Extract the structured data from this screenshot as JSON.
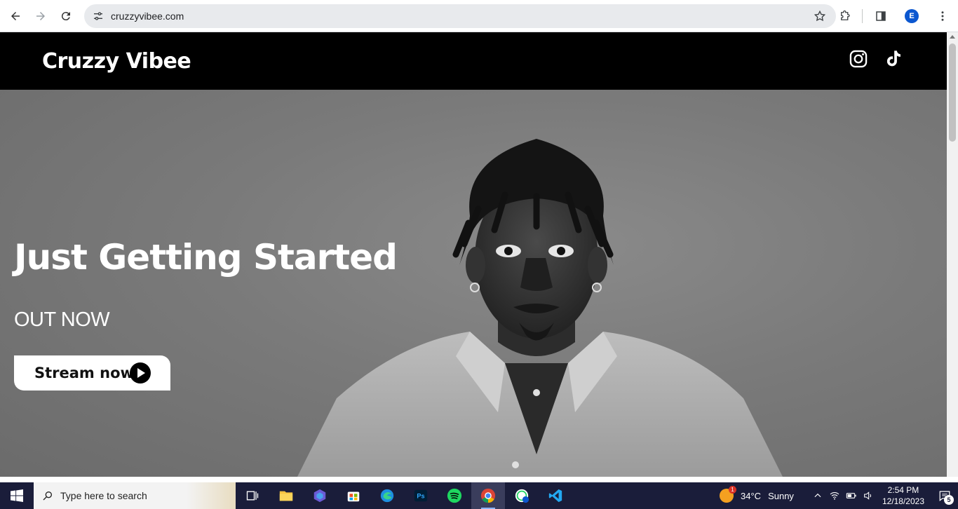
{
  "browser": {
    "url": "cruzzyvibee.com",
    "profile_initial": "E"
  },
  "site": {
    "brand": "Cruzzy Vibee",
    "social": [
      "instagram-icon",
      "tiktok-icon"
    ]
  },
  "hero": {
    "title": "Just Getting Started",
    "subtitle": "OUT NOW",
    "cta_label": "Stream now"
  },
  "taskbar": {
    "search_placeholder": "Type here to search",
    "apps": [
      "task-view-icon",
      "file-explorer-icon",
      "copilot-icon",
      "store-icon",
      "edge-icon",
      "photoshop-icon",
      "spotify-icon",
      "chrome-icon",
      "whatsapp-chrome-icon",
      "vscode-icon"
    ],
    "weather_temp": "34°C",
    "weather_text": "Sunny",
    "time": "2:54 PM",
    "date": "12/18/2023",
    "notification_count": "5"
  },
  "colors": {
    "header_bg": "#000000",
    "taskbar_bg": "#1a1d3a",
    "profile_accent": "#0b57d0"
  }
}
